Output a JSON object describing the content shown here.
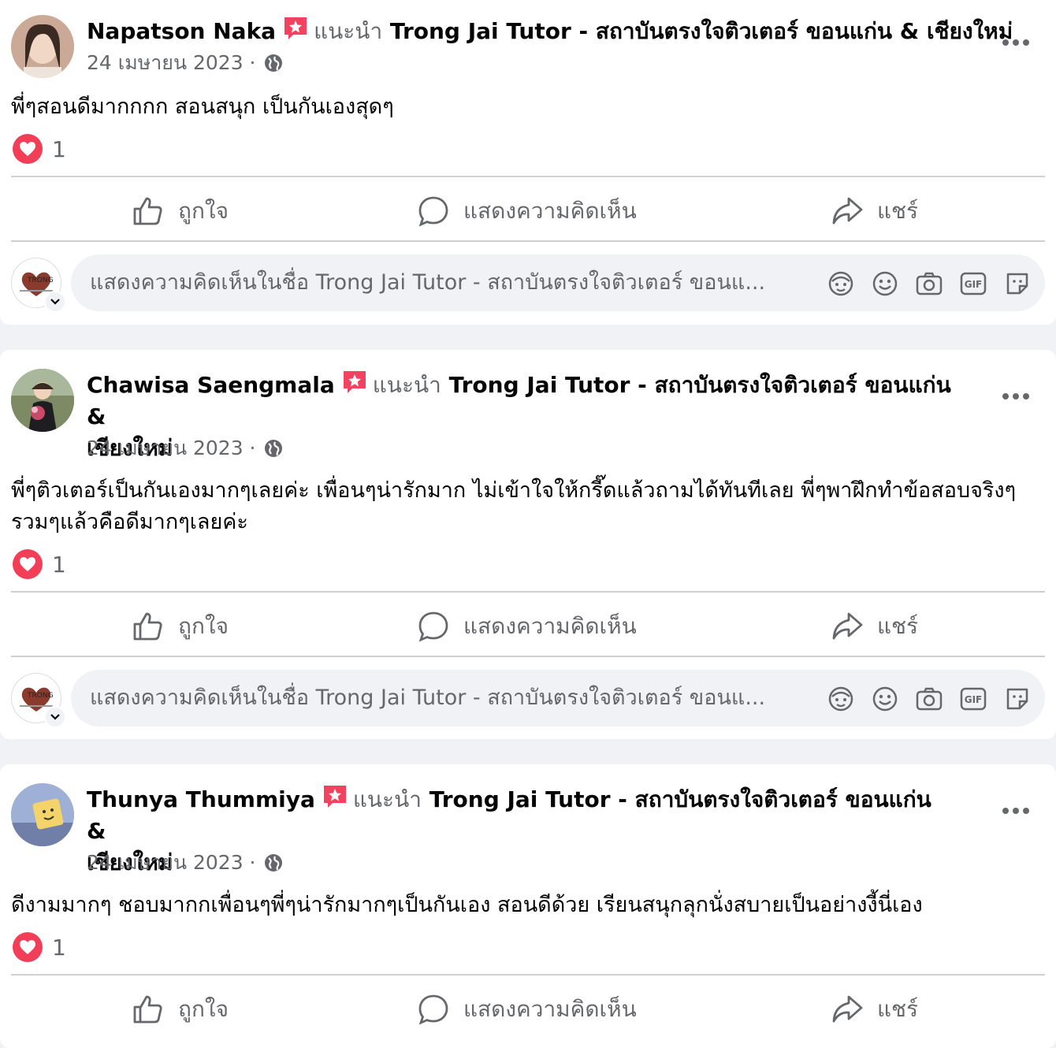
{
  "posts": [
    {
      "author": "Napatson Naka",
      "recommends": "แนะนำ",
      "page_line1": "Trong Jai Tutor - สถาบันตรงใจติวเตอร์ ขอนแก่น & เชียงใหม่",
      "page_line2": "",
      "date": "24 เมษายน 2023 ·",
      "text": "พี่ๆสอนดีมากกกก สอนสนุก เป็นกันเองสุดๆ",
      "reactions": "1",
      "avatar_color": "#7a5a4a"
    },
    {
      "author": "Chawisa Saengmala",
      "recommends": "แนะนำ",
      "page_line1": "Trong Jai Tutor - สถาบันตรงใจติวเตอร์ ขอนแก่น &",
      "page_line2": "เชียงใหม่",
      "date": "24 เมษายน 2023 ·",
      "text": "พี่ๆติวเตอร์เป็นกันเองมากๆเลยค่ะ เพื่อนๆน่ารักมาก ไม่เข้าใจให้กรี๊ดแล้วถามได้ทันทีเลย พี่ๆพาฝึกทำข้อสอบจริงๆ รวมๆแล้วคือดีมากๆเลยค่ะ",
      "reactions": "1",
      "avatar_color": "#6b7a55"
    },
    {
      "author": "Thunya Thummiya",
      "recommends": "แนะนำ",
      "page_line1": "Trong Jai Tutor - สถาบันตรงใจติวเตอร์ ขอนแก่น &",
      "page_line2": "เชียงใหม่",
      "date": "24 เมษายน 2023 ·",
      "text": "ดีงามมากๆ ชอบมากกเพื่อนๆพี่ๆน่ารักมากๆเป็นกันเอง สอนดีด้วย เรียนสนุกลุกนั่งสบายเป็นอย่างงี้นี่เอง",
      "reactions": "1",
      "avatar_color": "#8a9bc0"
    }
  ],
  "actions": {
    "like": "ถูกใจ",
    "comment": "แสดงความคิดเห็น",
    "share": "แชร์"
  },
  "comment_placeholder": "แสดงความคิดเห็นในชื่อ Trong Jai Tutor - สถาบันตรงใจติวเตอร์ ขอนแ...",
  "comment_icons": [
    "avatar-sticker-icon",
    "emoji-icon",
    "camera-icon",
    "gif-icon",
    "sticker-icon"
  ],
  "colors": {
    "heart": "#f33e58",
    "recommend_badge": "#f3425f",
    "secondary_text": "#65676b"
  }
}
